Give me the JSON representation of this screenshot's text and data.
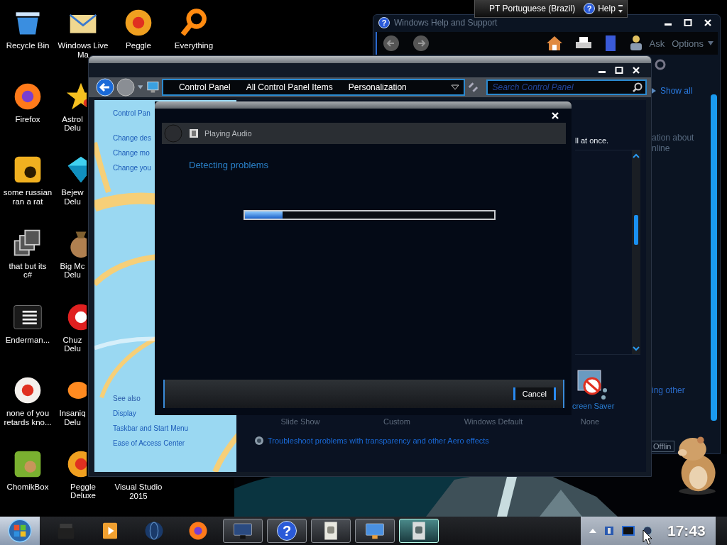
{
  "language_bar": {
    "language": "PT Portuguese (Brazil)",
    "help_glyph": "?",
    "help": "Help"
  },
  "desktop_columns": [
    [
      {
        "kind": "recycle",
        "lines": [
          "Recycle Bin"
        ]
      },
      {
        "kind": "firefox",
        "lines": [
          "Firefox"
        ]
      },
      {
        "kind": "de",
        "lines": [
          "some russian",
          "ran a rat"
        ]
      },
      {
        "kind": "stack",
        "lines": [
          "that but its",
          "c#"
        ]
      },
      {
        "kind": "terminal",
        "lines": [
          "Enderman..."
        ]
      },
      {
        "kind": "dragon",
        "lines": [
          "none of you",
          "retards kno..."
        ]
      },
      {
        "kind": "hamster",
        "lines": [
          "ChomikBox"
        ]
      }
    ],
    [
      {
        "kind": "mail",
        "lines": [
          "Windows Live",
          "Ma"
        ]
      },
      {
        "kind": "star",
        "lines": [
          "Astrol",
          "Delu"
        ]
      },
      {
        "kind": "gem",
        "lines": [
          "Bejew",
          "Delu"
        ]
      },
      {
        "kind": "bag",
        "lines": [
          "Big Mc",
          "Delu"
        ]
      },
      {
        "kind": "blob",
        "lines": [
          "Chuz",
          "Delu"
        ]
      },
      {
        "kind": "fish",
        "lines": [
          "Insaniq",
          "Delu"
        ]
      },
      {
        "kind": "peggle",
        "lines": [
          "Peggle",
          "Deluxe"
        ]
      }
    ],
    [
      {
        "kind": "peggle",
        "lines": [
          "Peggle"
        ]
      },
      {
        "kind": "none",
        "lines": [
          "Visual Studio",
          "2015"
        ]
      }
    ],
    [
      {
        "kind": "search",
        "lines": [
          "Everything"
        ]
      }
    ]
  ],
  "help_window": {
    "title": "Windows Help and Support",
    "ask": "Ask",
    "options": "Options",
    "show_all": "Show all",
    "text_fragments": [
      "ation about",
      "nline"
    ],
    "link_fragment": "ing other",
    "offline": "Offlin"
  },
  "control_panel": {
    "breadcrumbs": [
      "Control Panel",
      "All Control Panel Items",
      "Personalization"
    ],
    "search": {
      "placeholder": "Search Control Panel"
    },
    "left_pane": {
      "title": "Control Pan",
      "tasks": [
        "Change des",
        "Change mo",
        "Change you"
      ],
      "see_also": "See also",
      "see_also_links": [
        "Display",
        "Taskbar and Start Menu",
        "Ease of Access Center"
      ]
    },
    "content": {
      "fragment": "ll at once.",
      "screen_saver": "creen Saver",
      "themes": [
        "Slide Show",
        "Custom",
        "Windows Default",
        "None"
      ],
      "troubleshoot_link": "Troubleshoot problems with transparency and other Aero effects"
    }
  },
  "troubleshooter": {
    "title": "Playing Audio",
    "status": "Detecting problems",
    "progress": {
      "level": 0.15
    },
    "cancel": "Cancel"
  },
  "taskbar": {
    "pinned": [
      {
        "kind": "box"
      },
      {
        "kind": "media"
      },
      {
        "kind": "globe"
      },
      {
        "kind": "firefox"
      }
    ],
    "windows": [
      {
        "kind": "window",
        "selected": false
      },
      {
        "kind": "help",
        "glyph": "?",
        "selected": false
      },
      {
        "kind": "docs",
        "selected": false
      },
      {
        "kind": "display",
        "selected": false
      },
      {
        "kind": "troubleshooter",
        "selected": true
      }
    ],
    "clock": "17:43"
  }
}
